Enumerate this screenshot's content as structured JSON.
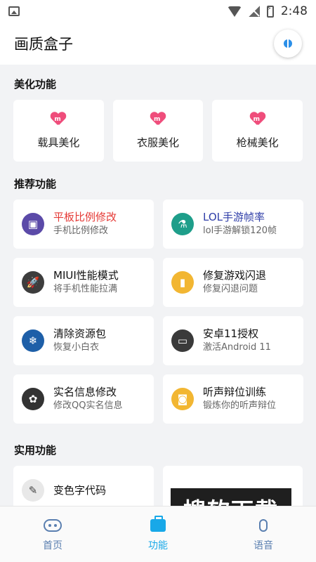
{
  "status_bar": {
    "time": "2:48"
  },
  "app_bar": {
    "title": "画质盒子"
  },
  "sections": {
    "beauty": {
      "title": "美化功能",
      "items": [
        {
          "label": "载具美化",
          "icon": "heart-m-icon"
        },
        {
          "label": "衣服美化",
          "icon": "heart-m-icon"
        },
        {
          "label": "枪械美化",
          "icon": "heart-m-icon"
        }
      ]
    },
    "recommended": {
      "title": "推荐功能",
      "items": [
        {
          "name": "平板比例修改",
          "desc": "手机比例修改",
          "name_color": "#e53935",
          "icon": "gameboy-icon",
          "icon_bg": "#5b4aa8",
          "glyph": "▣"
        },
        {
          "name": "LOL手游帧率",
          "desc": "lol手游解锁120帧",
          "name_color": "#2f3ea8",
          "icon": "test-tube-icon",
          "icon_bg": "#1e9e8a",
          "glyph": "⚗"
        },
        {
          "name": "MIUI性能模式",
          "desc": "将手机性能拉满",
          "name_color": "#111111",
          "icon": "rocket-icon",
          "icon_bg": "#3d3d3d",
          "glyph": "🚀"
        },
        {
          "name": "修复游戏闪退",
          "desc": "修复闪退问题",
          "name_color": "#111111",
          "icon": "phone-icon",
          "icon_bg": "#f2b632",
          "glyph": "▮"
        },
        {
          "name": "清除资源包",
          "desc": "恢复小白衣",
          "name_color": "#111111",
          "icon": "snowflake-icon",
          "icon_bg": "#1e5fa8",
          "glyph": "❄"
        },
        {
          "name": "安卓11授权",
          "desc": "激活Android 11",
          "name_color": "#111111",
          "icon": "laptop-icon",
          "icon_bg": "#3a3a3a",
          "glyph": "▭"
        },
        {
          "name": "实名信息修改",
          "desc": "修改QQ实名信息",
          "name_color": "#111111",
          "icon": "plant-icon",
          "icon_bg": "#333333",
          "glyph": "✿"
        },
        {
          "name": "听声辩位训练",
          "desc": "锻炼你的听声辩位",
          "name_color": "#111111",
          "icon": "radio-icon",
          "icon_bg": "#f2b632",
          "glyph": "◙"
        }
      ]
    },
    "utility": {
      "title": "实用功能",
      "items": [
        {
          "name": "变色字代码",
          "icon": "paint-icon",
          "icon_bg": "#e8e8e8"
        },
        {
          "name": "",
          "icon": "",
          "icon_bg": "#ffffff"
        }
      ]
    }
  },
  "bottom_nav": [
    {
      "label": "首页",
      "icon": "robot-icon",
      "active": false
    },
    {
      "label": "功能",
      "icon": "briefcase-icon",
      "active": true
    },
    {
      "label": "语音",
      "icon": "microphone-icon",
      "active": false
    }
  ],
  "watermark": "搜软下载",
  "colors": {
    "active_tab": "#18a8e8",
    "inactive_tab": "#5a7fb0"
  }
}
